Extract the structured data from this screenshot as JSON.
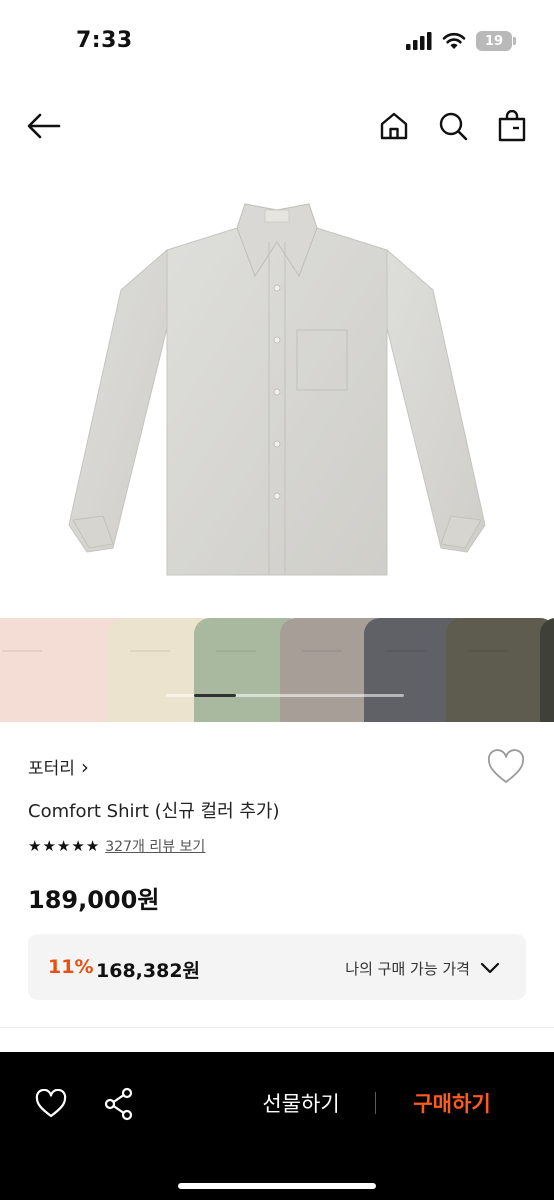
{
  "status_bar": {
    "time": "7:33",
    "battery": "19",
    "icons": [
      "signal-icon",
      "wifi-icon",
      "battery-icon"
    ]
  },
  "nav": {
    "icons": [
      "back-arrow-icon",
      "home-icon",
      "search-icon",
      "shopping-bag-icon"
    ]
  },
  "product": {
    "brand": "포터리",
    "brand_chevron": "›",
    "name": "Comfort Shirt (신규 컬러 추가)",
    "rating_stars": 5,
    "review_link": "327개 리뷰 보기",
    "price": "189,000원",
    "discount": "11%",
    "discounted_price": "168,382원",
    "my_price_label": "나의 구매 가능 가격"
  },
  "color_swatches": [
    {
      "name": "pink",
      "color": "#f3ddd4"
    },
    {
      "name": "beige",
      "color": "#ece3cf"
    },
    {
      "name": "sage",
      "color": "#a9b99f"
    },
    {
      "name": "grey-brown",
      "color": "#a79e98"
    },
    {
      "name": "charcoal",
      "color": "#5f6166"
    },
    {
      "name": "olive",
      "color": "#5d5c4f"
    },
    {
      "name": "dark-olive",
      "color": "#3f4138"
    }
  ],
  "bottom_bar": {
    "gift_label": "선물하기",
    "buy_label": "구매하기"
  },
  "colors": {
    "accent": "#ff5a1f",
    "discount": "#ea4f12",
    "shirt": "#d7d6d2"
  }
}
